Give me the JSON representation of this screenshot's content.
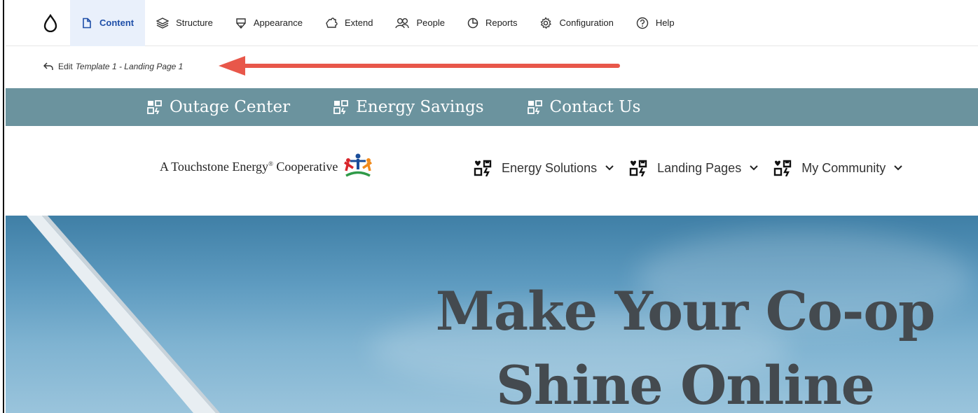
{
  "toolbar": {
    "items": [
      {
        "label": "Content",
        "icon": "file-icon",
        "active": true
      },
      {
        "label": "Structure",
        "icon": "layers-icon"
      },
      {
        "label": "Appearance",
        "icon": "brush-icon"
      },
      {
        "label": "Extend",
        "icon": "puzzle-icon"
      },
      {
        "label": "People",
        "icon": "people-icon"
      },
      {
        "label": "Reports",
        "icon": "pie-chart-icon"
      },
      {
        "label": "Configuration",
        "icon": "gear-icon"
      },
      {
        "label": "Help",
        "icon": "help-icon"
      }
    ],
    "active_color": "#1f4fa8"
  },
  "editbar": {
    "edit_label": "Edit",
    "template_name": "Template 1 - Landing Page 1"
  },
  "annotation": {
    "arrow_color": "#e8574a"
  },
  "utility": {
    "items": [
      "Outage Center",
      "Energy Savings",
      "Contact Us"
    ],
    "bg_color": "#6b939e"
  },
  "brand": {
    "text_before": "A Touchstone Energy",
    "registered": "®",
    "text_after": "Cooperative"
  },
  "mainnav": {
    "items": [
      "Energy Solutions",
      "Landing Pages",
      "My Community"
    ]
  },
  "hero": {
    "line1": "Make Your Co-op",
    "line2": "Shine Online"
  }
}
